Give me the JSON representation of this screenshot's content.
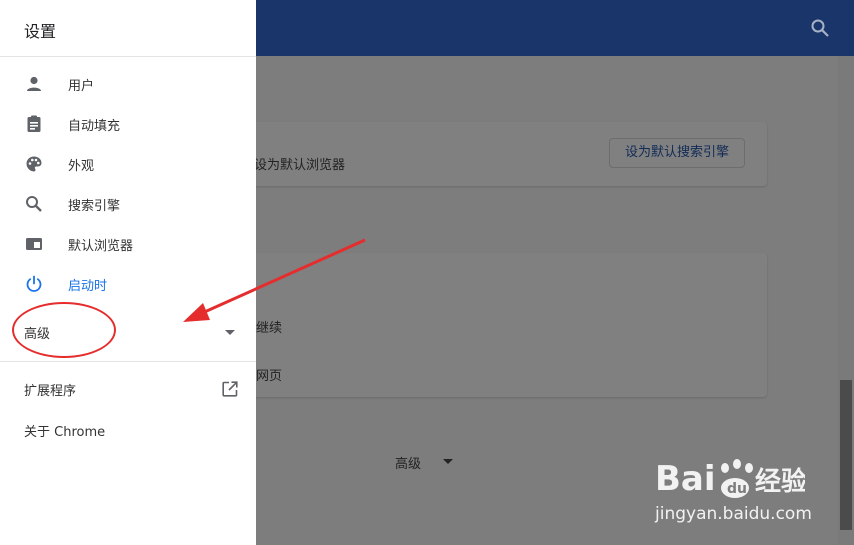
{
  "drawer": {
    "title": "设置",
    "items": [
      {
        "label": "用户",
        "icon": "person-icon"
      },
      {
        "label": "自动填充",
        "icon": "clipboard-icon"
      },
      {
        "label": "外观",
        "icon": "palette-icon"
      },
      {
        "label": "搜索引擎",
        "icon": "search-icon"
      },
      {
        "label": "默认浏览器",
        "icon": "browser-window-icon"
      },
      {
        "label": "启动时",
        "icon": "power-icon",
        "active": true
      }
    ],
    "advanced_label": "高级",
    "extensions_label": "扩展程序",
    "about_label": "关于 Chrome"
  },
  "main": {
    "default_browser_text": "设为默认浏览器",
    "set_default_search_button": "设为默认搜索引擎",
    "startup_option_1": "继续",
    "startup_option_2": "网页",
    "advanced_label": "高级"
  },
  "watermark": {
    "logo_text": "Bai du 经验",
    "url": "jingyan.baidu.com"
  },
  "colors": {
    "header": "#1a3569",
    "active": "#1a73e8",
    "annotation": "#e52d2d"
  }
}
